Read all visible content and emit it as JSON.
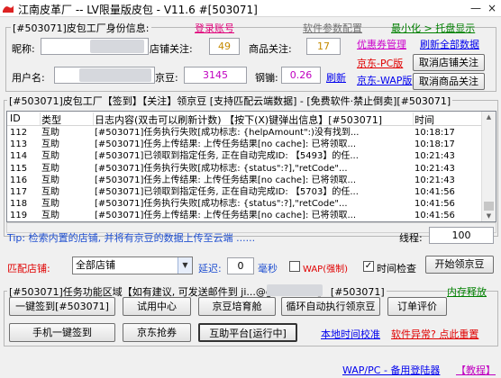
{
  "window": {
    "title": "江南皮革厂  --  LV限量版皮包 - V11.6  #[503071]",
    "controls": {
      "minimize": "—",
      "close": "×"
    }
  },
  "account": {
    "group_title": "[#503071]皮包工厂身份信息:",
    "login_link": "登录账号",
    "params_link": "软件参数配置",
    "minimize_link": "最小化 > 托盘显示",
    "nickname_label": "昵称:",
    "nickname_value": "",
    "shop_follow_label": "店铺关注:",
    "shop_follow_value": "49",
    "product_follow_label": "商品关注:",
    "product_follow_value": "17",
    "coupon_link": "优惠券管理",
    "refresh_all_link": "刷新全部数据",
    "jd_pc_link": "京东-PC版",
    "cancel_shop_button": "取消店铺关注",
    "username_label": "用户名:",
    "username_value": "",
    "jingdou_label": "京豆:",
    "jingdou_value": "3145",
    "steel_label": "钢镚:",
    "steel_value": "0.26",
    "refresh_link": "刷新",
    "jd_wap_link": "京东-WAP版",
    "cancel_product_button": "取消商品关注"
  },
  "log": {
    "group_title": "[#503071]皮包工厂【签到】【关注】领京豆 [支持匹配云端数据] - [免费软件·禁止倒卖][#503071]",
    "columns": [
      "ID",
      "类型",
      "日志内容(双击可以刷新计数) 【按下(X)键弹出信息】[#503071]",
      "时间"
    ],
    "rows": [
      {
        "id": "112",
        "type": "互助",
        "content": "[#503071]任务执行失败[成功标志: {helpAmount\":)没有找到...",
        "time": "10:18:17"
      },
      {
        "id": "113",
        "type": "互助",
        "content": "[#503071]任务上传结果: 上传任务结果[no cache]: 已将领取...",
        "time": "10:18:17"
      },
      {
        "id": "114",
        "type": "互助",
        "content": "[#503071]已领取到指定任务, 正在自动完成ID: 【5493】的任...",
        "time": "10:21:43"
      },
      {
        "id": "115",
        "type": "互助",
        "content": "[#503071]任务执行失败[成功标志: {status\":?],\"retCode\"...",
        "time": "10:21:43"
      },
      {
        "id": "116",
        "type": "互助",
        "content": "[#503071]任务上传结果: 上传任务结果[no cache]: 已将领取...",
        "time": "10:21:43"
      },
      {
        "id": "117",
        "type": "互助",
        "content": "[#503071]已领取到指定任务, 正在自动完成ID: 【5703】的任...",
        "time": "10:41:56"
      },
      {
        "id": "118",
        "type": "互助",
        "content": "[#503071]任务执行失败[成功标志: {status\":?],\"retCode\"...",
        "time": "10:41:56"
      },
      {
        "id": "119",
        "type": "互助",
        "content": "[#503071]任务上传结果: 上传任务结果[no cache]: 已将领取...",
        "time": "10:41:56"
      }
    ]
  },
  "controls": {
    "tip": "Tip: 检索内置的店铺, 并将有京豆的数据上传至云端 ......",
    "threads_label": "线程:",
    "threads_value": "100",
    "match_shop_label": "匹配店铺:",
    "shop_select_value": "全部店铺",
    "delay_label": "延迟:",
    "delay_value": "0",
    "delay_unit": "毫秒",
    "wap_label": "WAP(强制)",
    "wap_checked": false,
    "time_check_label": "时间检查",
    "time_check_checked": true,
    "start_button": "开始领京豆"
  },
  "function_area": {
    "group_title": "[#503071]任务功能区域【如有建议, 可发送邮件到 ji...@gmail.com】 [#503071]",
    "memory_link": "内存释放",
    "buttons_row1": [
      "一键签到[#503071]",
      "试用中心",
      "京豆培育舱",
      "循环自动执行领京豆",
      "订单评价"
    ],
    "buttons_row2": [
      "手机一键签到",
      "京东抢券",
      "互助平台[运行中]"
    ],
    "local_time_link": "本地时间校准",
    "error_link": "软件异常? 点此重置"
  },
  "footer": {
    "backup_link": "WAP/PC - 备用登陆器",
    "tutorial_link": "【教程】"
  },
  "colors": {
    "link_blue": "#0000ff",
    "accent_green": "#008000",
    "orange": "#d38600",
    "red": "#e00000",
    "magenta": "#c000c0"
  }
}
